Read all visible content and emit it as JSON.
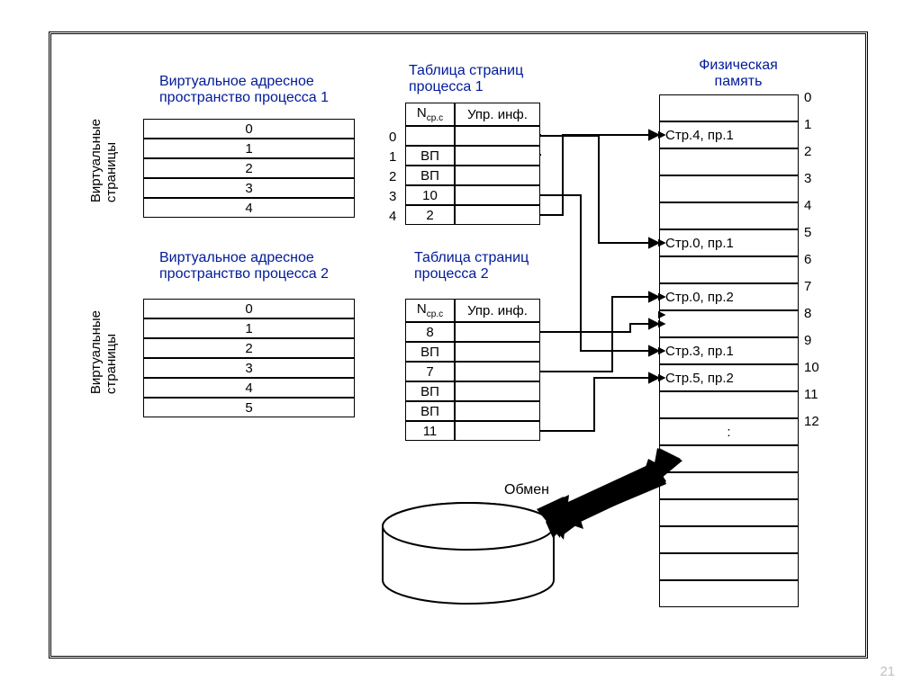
{
  "titles": {
    "vas1_l1": "Виртуальное адресное",
    "vas1_l2": "пространство процесса 1",
    "pt1_l1": "Таблица страниц",
    "pt1_l2": "процесса 1",
    "phys_l1": "Физическая",
    "phys_l2": "память",
    "vas2_l1": "Виртуальное адресное",
    "vas2_l2": "пространство процесса 2",
    "pt2_l1": "Таблица страниц",
    "pt2_l2": "процесса 2",
    "vlabel": "Виртуальные\nстраницы",
    "swap": "Обмен"
  },
  "vas1": [
    "0",
    "1",
    "2",
    "3",
    "4"
  ],
  "vas2": [
    "0",
    "1",
    "2",
    "3",
    "4",
    "5"
  ],
  "pt_header": {
    "col1": "Nср.с",
    "col2": "Упр. инф."
  },
  "pt1": {
    "idx": [
      "0",
      "1",
      "2",
      "3",
      "4"
    ],
    "col1": [
      "",
      "ВП",
      "ВП",
      "10",
      "2"
    ]
  },
  "pt2": {
    "col1": [
      "8",
      "ВП",
      "7",
      "ВП",
      "ВП",
      "11"
    ]
  },
  "phys": {
    "idx": [
      "0",
      "1",
      "2",
      "3",
      "4",
      "5",
      "6",
      "7",
      "8",
      "9",
      "10",
      "11",
      "12"
    ],
    "rows": [
      "",
      "Стр.4, пр.1",
      "",
      "",
      "",
      "Стр.0, пр.1",
      "",
      "Стр.0, пр.2",
      "",
      "Стр.3, пр.1",
      "Стр.5, пр.2",
      "",
      ":"
    ]
  },
  "page_num": "21"
}
